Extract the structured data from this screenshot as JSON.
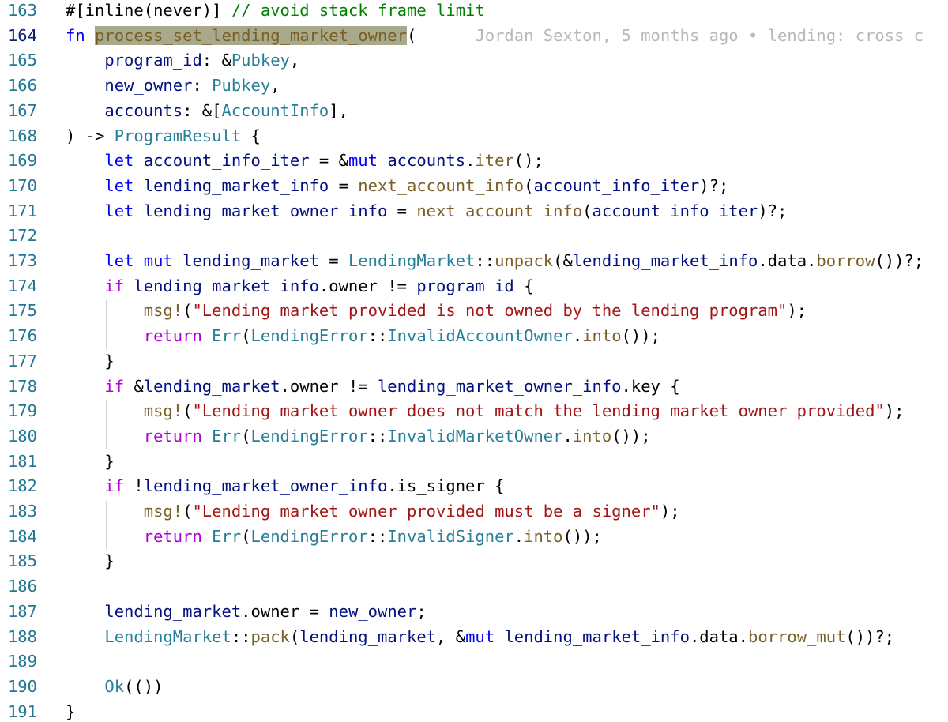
{
  "editor": {
    "language": "rust",
    "current_line": "164",
    "blame": "Jordan Sexton, 5 months ago • lending: cross c",
    "lines": [
      {
        "n": "163",
        "tokens": [
          {
            "t": "#[inline(never)] ",
            "c": ""
          },
          {
            "t": "// avoid stack frame limit",
            "c": "cmt"
          }
        ]
      },
      {
        "n": "164",
        "tokens": [
          {
            "t": "fn",
            "c": "kw"
          },
          {
            "t": " ",
            "c": ""
          },
          {
            "t": "process_set_lending_market_owner",
            "c": "fnc hl"
          },
          {
            "t": "(",
            "c": ""
          }
        ]
      },
      {
        "n": "165",
        "tokens": [
          {
            "t": "    ",
            "c": ""
          },
          {
            "t": "program_id",
            "c": "var"
          },
          {
            "t": ": &",
            "c": ""
          },
          {
            "t": "Pubkey",
            "c": "ty"
          },
          {
            "t": ",",
            "c": ""
          }
        ]
      },
      {
        "n": "166",
        "tokens": [
          {
            "t": "    ",
            "c": ""
          },
          {
            "t": "new_owner",
            "c": "var"
          },
          {
            "t": ": ",
            "c": ""
          },
          {
            "t": "Pubkey",
            "c": "ty"
          },
          {
            "t": ",",
            "c": ""
          }
        ]
      },
      {
        "n": "167",
        "tokens": [
          {
            "t": "    ",
            "c": ""
          },
          {
            "t": "accounts",
            "c": "var"
          },
          {
            "t": ": &[",
            "c": ""
          },
          {
            "t": "AccountInfo",
            "c": "ty"
          },
          {
            "t": "],",
            "c": ""
          }
        ]
      },
      {
        "n": "168",
        "tokens": [
          {
            "t": ") -> ",
            "c": ""
          },
          {
            "t": "ProgramResult",
            "c": "ty"
          },
          {
            "t": " {",
            "c": ""
          }
        ]
      },
      {
        "n": "169",
        "tokens": [
          {
            "t": "    ",
            "c": ""
          },
          {
            "t": "let",
            "c": "kw"
          },
          {
            "t": " ",
            "c": ""
          },
          {
            "t": "account_info_iter",
            "c": "var"
          },
          {
            "t": " = &",
            "c": ""
          },
          {
            "t": "mut",
            "c": "kw"
          },
          {
            "t": " ",
            "c": ""
          },
          {
            "t": "accounts",
            "c": "var"
          },
          {
            "t": ".",
            "c": ""
          },
          {
            "t": "iter",
            "c": "fnc"
          },
          {
            "t": "();",
            "c": ""
          }
        ]
      },
      {
        "n": "170",
        "tokens": [
          {
            "t": "    ",
            "c": ""
          },
          {
            "t": "let",
            "c": "kw"
          },
          {
            "t": " ",
            "c": ""
          },
          {
            "t": "lending_market_info",
            "c": "var"
          },
          {
            "t": " = ",
            "c": ""
          },
          {
            "t": "next_account_info",
            "c": "fnc"
          },
          {
            "t": "(",
            "c": ""
          },
          {
            "t": "account_info_iter",
            "c": "var"
          },
          {
            "t": ")?;",
            "c": ""
          }
        ]
      },
      {
        "n": "171",
        "tokens": [
          {
            "t": "    ",
            "c": ""
          },
          {
            "t": "let",
            "c": "kw"
          },
          {
            "t": " ",
            "c": ""
          },
          {
            "t": "lending_market_owner_info",
            "c": "var"
          },
          {
            "t": " = ",
            "c": ""
          },
          {
            "t": "next_account_info",
            "c": "fnc"
          },
          {
            "t": "(",
            "c": ""
          },
          {
            "t": "account_info_iter",
            "c": "var"
          },
          {
            "t": ")?;",
            "c": ""
          }
        ]
      },
      {
        "n": "172",
        "tokens": []
      },
      {
        "n": "173",
        "tokens": [
          {
            "t": "    ",
            "c": ""
          },
          {
            "t": "let",
            "c": "kw"
          },
          {
            "t": " ",
            "c": ""
          },
          {
            "t": "mut",
            "c": "kw"
          },
          {
            "t": " ",
            "c": ""
          },
          {
            "t": "lending_market",
            "c": "var"
          },
          {
            "t": " = ",
            "c": ""
          },
          {
            "t": "LendingMarket",
            "c": "ty"
          },
          {
            "t": "::",
            "c": ""
          },
          {
            "t": "unpack",
            "c": "fnc"
          },
          {
            "t": "(&",
            "c": ""
          },
          {
            "t": "lending_market_info",
            "c": "var"
          },
          {
            "t": ".data.",
            "c": ""
          },
          {
            "t": "borrow",
            "c": "fnc"
          },
          {
            "t": "())?;",
            "c": ""
          }
        ]
      },
      {
        "n": "174",
        "tokens": [
          {
            "t": "    ",
            "c": ""
          },
          {
            "t": "if",
            "c": "ctl"
          },
          {
            "t": " ",
            "c": ""
          },
          {
            "t": "lending_market_info",
            "c": "var"
          },
          {
            "t": ".owner != ",
            "c": ""
          },
          {
            "t": "program_id",
            "c": "var"
          },
          {
            "t": " {",
            "c": ""
          }
        ]
      },
      {
        "n": "175",
        "tokens": [
          {
            "t": "        ",
            "c": ""
          },
          {
            "t": "msg!",
            "c": "fnc"
          },
          {
            "t": "(",
            "c": ""
          },
          {
            "t": "\"Lending market provided is not owned by the lending program\"",
            "c": "str"
          },
          {
            "t": ");",
            "c": ""
          }
        ]
      },
      {
        "n": "176",
        "tokens": [
          {
            "t": "        ",
            "c": ""
          },
          {
            "t": "return",
            "c": "ctl"
          },
          {
            "t": " ",
            "c": ""
          },
          {
            "t": "Err",
            "c": "ty"
          },
          {
            "t": "(",
            "c": ""
          },
          {
            "t": "LendingError",
            "c": "ty"
          },
          {
            "t": "::",
            "c": ""
          },
          {
            "t": "InvalidAccountOwner",
            "c": "ty"
          },
          {
            "t": ".",
            "c": ""
          },
          {
            "t": "into",
            "c": "fnc"
          },
          {
            "t": "());",
            "c": ""
          }
        ]
      },
      {
        "n": "177",
        "tokens": [
          {
            "t": "    }",
            "c": ""
          }
        ]
      },
      {
        "n": "178",
        "tokens": [
          {
            "t": "    ",
            "c": ""
          },
          {
            "t": "if",
            "c": "ctl"
          },
          {
            "t": " &",
            "c": ""
          },
          {
            "t": "lending_market",
            "c": "var"
          },
          {
            "t": ".owner != ",
            "c": ""
          },
          {
            "t": "lending_market_owner_info",
            "c": "var"
          },
          {
            "t": ".key {",
            "c": ""
          }
        ]
      },
      {
        "n": "179",
        "tokens": [
          {
            "t": "        ",
            "c": ""
          },
          {
            "t": "msg!",
            "c": "fnc"
          },
          {
            "t": "(",
            "c": ""
          },
          {
            "t": "\"Lending market owner does not match the lending market owner provided\"",
            "c": "str"
          },
          {
            "t": ");",
            "c": ""
          }
        ]
      },
      {
        "n": "180",
        "tokens": [
          {
            "t": "        ",
            "c": ""
          },
          {
            "t": "return",
            "c": "ctl"
          },
          {
            "t": " ",
            "c": ""
          },
          {
            "t": "Err",
            "c": "ty"
          },
          {
            "t": "(",
            "c": ""
          },
          {
            "t": "LendingError",
            "c": "ty"
          },
          {
            "t": "::",
            "c": ""
          },
          {
            "t": "InvalidMarketOwner",
            "c": "ty"
          },
          {
            "t": ".",
            "c": ""
          },
          {
            "t": "into",
            "c": "fnc"
          },
          {
            "t": "());",
            "c": ""
          }
        ]
      },
      {
        "n": "181",
        "tokens": [
          {
            "t": "    }",
            "c": ""
          }
        ]
      },
      {
        "n": "182",
        "tokens": [
          {
            "t": "    ",
            "c": ""
          },
          {
            "t": "if",
            "c": "ctl"
          },
          {
            "t": " !",
            "c": ""
          },
          {
            "t": "lending_market_owner_info",
            "c": "var"
          },
          {
            "t": ".is_signer {",
            "c": ""
          }
        ]
      },
      {
        "n": "183",
        "tokens": [
          {
            "t": "        ",
            "c": ""
          },
          {
            "t": "msg!",
            "c": "fnc"
          },
          {
            "t": "(",
            "c": ""
          },
          {
            "t": "\"Lending market owner provided must be a signer\"",
            "c": "str"
          },
          {
            "t": ");",
            "c": ""
          }
        ]
      },
      {
        "n": "184",
        "tokens": [
          {
            "t": "        ",
            "c": ""
          },
          {
            "t": "return",
            "c": "ctl"
          },
          {
            "t": " ",
            "c": ""
          },
          {
            "t": "Err",
            "c": "ty"
          },
          {
            "t": "(",
            "c": ""
          },
          {
            "t": "LendingError",
            "c": "ty"
          },
          {
            "t": "::",
            "c": ""
          },
          {
            "t": "InvalidSigner",
            "c": "ty"
          },
          {
            "t": ".",
            "c": ""
          },
          {
            "t": "into",
            "c": "fnc"
          },
          {
            "t": "());",
            "c": ""
          }
        ]
      },
      {
        "n": "185",
        "tokens": [
          {
            "t": "    }",
            "c": ""
          }
        ]
      },
      {
        "n": "186",
        "tokens": []
      },
      {
        "n": "187",
        "tokens": [
          {
            "t": "    ",
            "c": ""
          },
          {
            "t": "lending_market",
            "c": "var"
          },
          {
            "t": ".owner = ",
            "c": ""
          },
          {
            "t": "new_owner",
            "c": "var"
          },
          {
            "t": ";",
            "c": ""
          }
        ]
      },
      {
        "n": "188",
        "tokens": [
          {
            "t": "    ",
            "c": ""
          },
          {
            "t": "LendingMarket",
            "c": "ty"
          },
          {
            "t": "::",
            "c": ""
          },
          {
            "t": "pack",
            "c": "fnc"
          },
          {
            "t": "(",
            "c": ""
          },
          {
            "t": "lending_market",
            "c": "var"
          },
          {
            "t": ", &",
            "c": ""
          },
          {
            "t": "mut",
            "c": "kw"
          },
          {
            "t": " ",
            "c": ""
          },
          {
            "t": "lending_market_info",
            "c": "var"
          },
          {
            "t": ".data.",
            "c": ""
          },
          {
            "t": "borrow_mut",
            "c": "fnc"
          },
          {
            "t": "())?;",
            "c": ""
          }
        ]
      },
      {
        "n": "189",
        "tokens": []
      },
      {
        "n": "190",
        "tokens": [
          {
            "t": "    ",
            "c": ""
          },
          {
            "t": "Ok",
            "c": "ty"
          },
          {
            "t": "(())",
            "c": ""
          }
        ]
      },
      {
        "n": "191",
        "tokens": [
          {
            "t": "}",
            "c": ""
          }
        ]
      }
    ]
  },
  "colors": {
    "line_number": "#237893",
    "line_number_active": "#0b216f",
    "keyword": "#0000ff",
    "control": "#af00db",
    "type": "#267f99",
    "function": "#795e26",
    "variable": "#001080",
    "string": "#a31515",
    "comment": "#008000",
    "highlight": "#a8a98a",
    "blame": "#b8b8b8"
  }
}
